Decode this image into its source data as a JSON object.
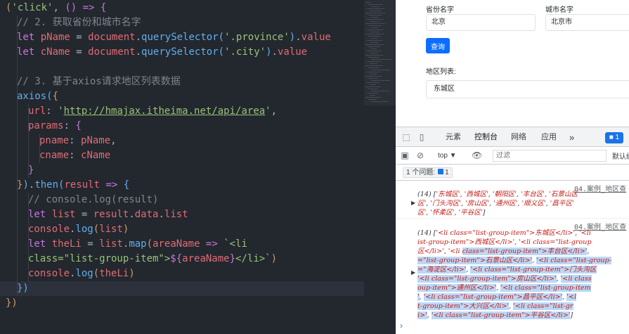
{
  "editor": {
    "lines": [
      {
        "ind": 0,
        "t": [
          [
            "br1",
            "("
          ],
          [
            "str",
            "'click'"
          ],
          [
            "punc",
            ", "
          ],
          [
            "br2",
            "()"
          ],
          [
            "kw",
            " => "
          ],
          [
            "br2",
            "{"
          ]
        ]
      },
      {
        "ind": 1,
        "t": [
          [
            "cm",
            "// 2. 获取省份和城市名字"
          ]
        ]
      },
      {
        "ind": 1,
        "t": [
          [
            "kw",
            "let "
          ],
          [
            "var",
            "pName"
          ],
          [
            "punc",
            " = "
          ],
          [
            "var",
            "document"
          ],
          [
            "punc",
            "."
          ],
          [
            "fn",
            "querySelector"
          ],
          [
            "br3",
            "("
          ],
          [
            "str",
            "'.province'"
          ],
          [
            "br3",
            ")"
          ],
          [
            "punc",
            "."
          ],
          [
            "var",
            "value"
          ]
        ]
      },
      {
        "ind": 1,
        "t": [
          [
            "kw",
            "let "
          ],
          [
            "var",
            "cName"
          ],
          [
            "punc",
            " = "
          ],
          [
            "var",
            "document"
          ],
          [
            "punc",
            "."
          ],
          [
            "fn",
            "querySelector"
          ],
          [
            "br3",
            "("
          ],
          [
            "str",
            "'.city'"
          ],
          [
            "br3",
            ")"
          ],
          [
            "punc",
            "."
          ],
          [
            "var",
            "value"
          ]
        ]
      },
      {
        "ind": 0,
        "t": []
      },
      {
        "ind": 1,
        "t": [
          [
            "cm",
            "// 3. 基于axios请求地区列表数据"
          ]
        ]
      },
      {
        "ind": 1,
        "t": [
          [
            "fn",
            "axios"
          ],
          [
            "br3",
            "("
          ],
          [
            "br1",
            "{"
          ]
        ]
      },
      {
        "ind": 2,
        "t": [
          [
            "prop",
            "url"
          ],
          [
            "punc",
            ": "
          ],
          [
            "str",
            "'"
          ],
          [
            "url",
            "http://hmajax.itheima.net/api/area"
          ],
          [
            "str",
            "'"
          ],
          [
            "punc",
            ","
          ]
        ]
      },
      {
        "ind": 2,
        "t": [
          [
            "prop",
            "params"
          ],
          [
            "punc",
            ": "
          ],
          [
            "br2",
            "{"
          ]
        ]
      },
      {
        "ind": 3,
        "t": [
          [
            "prop",
            "pname"
          ],
          [
            "punc",
            ": "
          ],
          [
            "var",
            "pName"
          ],
          [
            "punc",
            ","
          ]
        ]
      },
      {
        "ind": 3,
        "t": [
          [
            "prop",
            "cname"
          ],
          [
            "punc",
            ": "
          ],
          [
            "var",
            "cName"
          ]
        ]
      },
      {
        "ind": 2,
        "t": [
          [
            "br2",
            "}"
          ]
        ]
      },
      {
        "ind": 1,
        "t": [
          [
            "br1",
            "}"
          ],
          [
            "br3",
            ")"
          ],
          [
            "punc",
            "."
          ],
          [
            "fn",
            "then"
          ],
          [
            "br3",
            "("
          ],
          [
            "var",
            "result"
          ],
          [
            "kw",
            " => "
          ],
          [
            "br3",
            "{"
          ]
        ]
      },
      {
        "ind": 2,
        "t": [
          [
            "cm",
            "// console.log(result)"
          ]
        ]
      },
      {
        "ind": 2,
        "t": [
          [
            "kw",
            "let "
          ],
          [
            "var",
            "list"
          ],
          [
            "punc",
            " = "
          ],
          [
            "var",
            "result"
          ],
          [
            "punc",
            "."
          ],
          [
            "var",
            "data"
          ],
          [
            "punc",
            "."
          ],
          [
            "var",
            "list"
          ]
        ]
      },
      {
        "ind": 2,
        "t": [
          [
            "var",
            "console"
          ],
          [
            "punc",
            "."
          ],
          [
            "fn",
            "log"
          ],
          [
            "br1",
            "("
          ],
          [
            "var",
            "list"
          ],
          [
            "br1",
            ")"
          ]
        ]
      },
      {
        "ind": 2,
        "t": [
          [
            "kw",
            "let "
          ],
          [
            "var",
            "theLi"
          ],
          [
            "punc",
            " = "
          ],
          [
            "var",
            "list"
          ],
          [
            "punc",
            "."
          ],
          [
            "fn",
            "map"
          ],
          [
            "br1",
            "("
          ],
          [
            "var",
            "areaName"
          ],
          [
            "kw",
            " => "
          ],
          [
            "tpl",
            "`<li"
          ]
        ]
      },
      {
        "ind": 2,
        "t": [
          [
            "tpl",
            "class=\"list-group-item\">"
          ],
          [
            "kw",
            "${"
          ],
          [
            "var",
            "areaName"
          ],
          [
            "kw",
            "}"
          ],
          [
            "tpl",
            "</li>`"
          ],
          [
            "br1",
            ")"
          ]
        ]
      },
      {
        "ind": 2,
        "t": [
          [
            "var",
            "console"
          ],
          [
            "punc",
            "."
          ],
          [
            "fn",
            "log"
          ],
          [
            "br1",
            "("
          ],
          [
            "var",
            "theLi"
          ],
          [
            "br1",
            ")"
          ]
        ]
      },
      {
        "ind": 1,
        "t": [
          [
            "br3",
            "})"
          ]
        ]
      },
      {
        "ind": 0,
        "t": [
          [
            "br1",
            "})"
          ]
        ]
      }
    ]
  },
  "preview": {
    "province_label": "省份名字",
    "city_label": "城市名字",
    "province_value": "北京",
    "city_value": "北京市",
    "query_button": "查询",
    "area_label": "地区列表:",
    "area_items": [
      "东城区"
    ]
  },
  "devtools": {
    "tabs": [
      "元素",
      "控制台",
      "网络",
      "应用"
    ],
    "active_tab": "控制台",
    "more_tabs": "»",
    "issues_badge": "1",
    "context": "top ▼",
    "filter_placeholder": "过滤",
    "levels_label": "默认级",
    "issues_text": "1 个问题:",
    "issues_count": "1",
    "log_source_1": "04.案例_地区查",
    "log_source_2": "04.案例_地区查",
    "log1_lines": [
      [
        [
          "cnt",
          "(14) ["
        ],
        [
          "s",
          "'东城区'"
        ],
        [
          "cnt",
          ", "
        ],
        [
          "s",
          "'西城区'"
        ],
        [
          "cnt",
          ", "
        ],
        [
          "s",
          "'朝阳区'"
        ],
        [
          "cnt",
          ", "
        ],
        [
          "s",
          "'丰台区'"
        ],
        [
          "cnt",
          ", "
        ],
        [
          "s",
          "'石景山区"
        ]
      ],
      [
        [
          "s",
          "区'"
        ],
        [
          "cnt",
          ", "
        ],
        [
          "s",
          "'门头沟区'"
        ],
        [
          "cnt",
          ", "
        ],
        [
          "s",
          "'房山区'"
        ],
        [
          "cnt",
          ", "
        ],
        [
          "s",
          "'通州区'"
        ],
        [
          "cnt",
          ", "
        ],
        [
          "s",
          "'顺义区'"
        ],
        [
          "cnt",
          ", "
        ],
        [
          "s",
          "'昌平区'"
        ]
      ],
      [
        [
          "s",
          "区'"
        ],
        [
          "cnt",
          ", "
        ],
        [
          "s",
          "'怀柔区'"
        ],
        [
          "cnt",
          ", "
        ],
        [
          "s",
          "'平谷区'"
        ],
        [
          "cnt",
          "]"
        ]
      ]
    ],
    "log2_lines": [
      [
        [
          "cnt",
          "(14) ["
        ],
        [
          "s",
          "'<li class=\"list-group-item\">东城区</li>'"
        ],
        [
          "cnt",
          ", "
        ],
        [
          "s",
          "'<li"
        ]
      ],
      [
        [
          "s",
          "ist-group-item\">西城区</li>'"
        ],
        [
          "cnt",
          ", "
        ],
        [
          "s",
          "'<li class=\"list-group"
        ]
      ],
      [
        [
          "s",
          "区</li>'"
        ],
        [
          "cnt",
          ", "
        ],
        [
          "s",
          "'<li "
        ],
        [
          "sel",
          "class=\"list-group-item\">丰台区</li>'"
        ],
        [
          "cnt",
          ", "
        ]
      ],
      [
        [
          "sel",
          "=\"list-group-item\">石景山区</li>'"
        ],
        [
          "cnt",
          ", "
        ],
        [
          "sel",
          "'<li class=\"list-group-"
        ]
      ],
      [
        [
          "sel",
          "=\"海淀区</li>'"
        ],
        [
          "cnt",
          ", "
        ],
        [
          "sel",
          "'<li class=\"list-group-item\">门头沟区"
        ]
      ],
      [
        [
          "sel",
          "'<li class=\"list-group-item\">房山区</li>'"
        ],
        [
          "cnt",
          ", "
        ],
        [
          "sel",
          "'<li class"
        ]
      ],
      [
        [
          "sel",
          "oup-item\">通州区</li>'"
        ],
        [
          "cnt",
          ", "
        ],
        [
          "sel",
          "'<li class=\"list-group-item"
        ]
      ],
      [
        [
          "sel",
          "'"
        ],
        [
          "cnt",
          ", "
        ],
        [
          "sel",
          "'<li class=\"list-group-item\">昌平区</li>'"
        ],
        [
          "cnt",
          ", "
        ],
        [
          "sel",
          "'<l"
        ]
      ],
      [
        [
          "sel",
          "t-group-item\">大兴区</li>'"
        ],
        [
          "cnt",
          ", "
        ],
        [
          "sel",
          "'<li class=\"list-gr"
        ]
      ],
      [
        [
          "sel",
          "i>'"
        ],
        [
          "cnt",
          ", "
        ],
        [
          "sel",
          "'<li class=\"list-group-item\">平谷区</li>'"
        ],
        [
          "cnt",
          "]"
        ]
      ]
    ],
    "prompt": "›"
  }
}
